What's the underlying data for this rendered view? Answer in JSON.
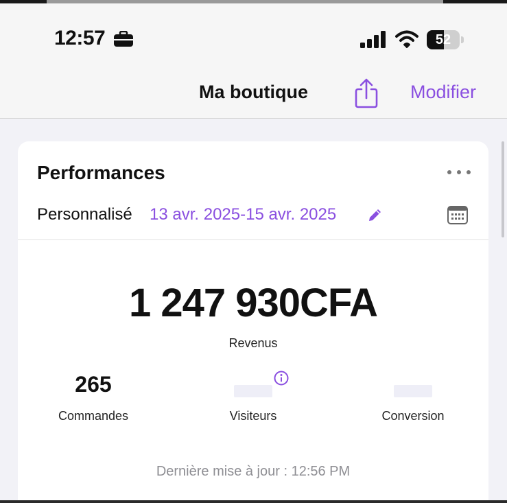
{
  "status_bar": {
    "time": "12:57",
    "battery_text": "52",
    "battery_level": 0.52,
    "icons": [
      "briefcase-icon",
      "cellular-signal-icon",
      "wifi-icon",
      "battery-icon"
    ]
  },
  "navbar": {
    "title": "Ma boutique",
    "share_icon": "share-icon",
    "modify_label": "Modifier"
  },
  "colors": {
    "accent": "#8a4fe0",
    "background": "#f2f2f7",
    "card": "#ffffff",
    "muted_text": "#8e8e93"
  },
  "performance": {
    "title": "Performances",
    "range_label": "Personnalisé",
    "range_dates": "13 avr. 2025-15 avr. 2025",
    "revenue": "1 247 930CFA",
    "revenue_label": "Revenus",
    "stats": [
      {
        "value": "265",
        "label": "Commandes"
      },
      {
        "value": "",
        "label": "Visiteurs"
      },
      {
        "value": "",
        "label": "Conversion"
      }
    ],
    "last_updated": "Dernière mise à jour : 12:56 PM"
  }
}
